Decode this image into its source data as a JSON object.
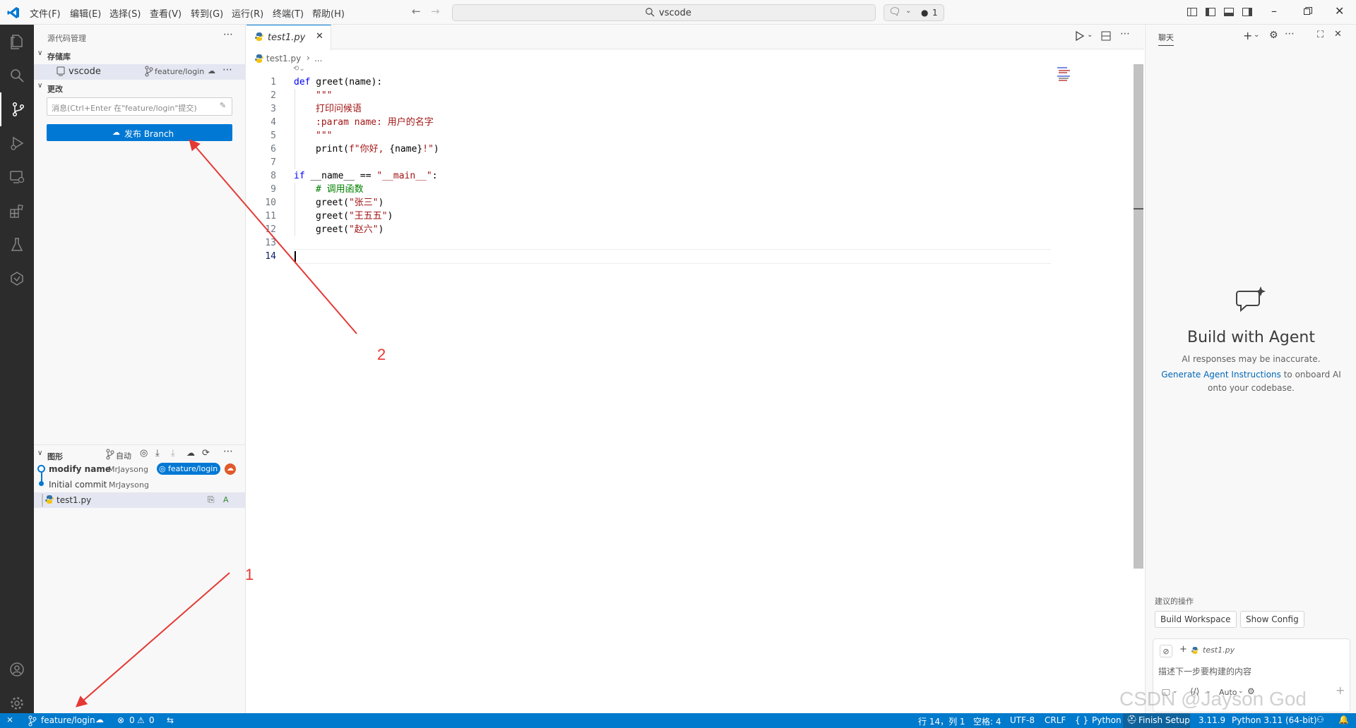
{
  "titlebar": {
    "menus": [
      "文件(F)",
      "编辑(E)",
      "选择(S)",
      "查看(V)",
      "转到(G)",
      "运行(R)",
      "终端(T)",
      "帮助(H)"
    ],
    "search_text": "vscode",
    "badge": "1"
  },
  "sidebar": {
    "title": "源代码管理",
    "repos_header": "存储库",
    "repo_name": "vscode",
    "repo_branch": "feature/login",
    "changes_header": "更改",
    "commit_placeholder": "消息(Ctrl+Enter 在\"feature/login\"提交)",
    "publish_label": "发布 Branch",
    "graph_header": "图形",
    "graph_auto": "自动",
    "commits": [
      {
        "message": "modify name",
        "author": "MrJaysong",
        "branch": "feature/login"
      },
      {
        "message": "Initial commit",
        "author": "MrJaysong"
      }
    ],
    "file": {
      "name": "test1.py",
      "status": "A"
    }
  },
  "editor": {
    "tab_label": "test1.py",
    "breadcrumb_file": "test1.py",
    "breadcrumb_more": "...",
    "line_numbers": [
      "1",
      "2",
      "3",
      "4",
      "5",
      "6",
      "7",
      "8",
      "9",
      "10",
      "11",
      "12",
      "13",
      "14"
    ],
    "code": {
      "l1_kw": "def",
      "l1_rest": " greet(name):",
      "l2": "\"\"\"",
      "l3": "打印问候语",
      "l4": ":param name: 用户的名字",
      "l5": "\"\"\"",
      "l6_a": "print(",
      "l6_b": "f\"你好, ",
      "l6_c": "{name}",
      "l6_d": "!\"",
      "l6_e": ")",
      "l8_kw": "if",
      "l8_rest": " __name__ == ",
      "l8_str": "\"__main__\"",
      "l8_end": ":",
      "l9": "# 调用函数",
      "l10_a": "greet(",
      "l10_b": "\"张三\"",
      "l10_c": ")",
      "l11_a": "greet(",
      "l11_b": "\"王五五\"",
      "l11_c": ")",
      "l12_a": "greet(",
      "l12_b": "\"赵六\"",
      "l12_c": ")"
    }
  },
  "annotations": {
    "label_1": "1",
    "label_2": "2",
    "arrow_color": "#e53935"
  },
  "chat": {
    "tab": "聊天",
    "heading": "Build with Agent",
    "disclaimer": "AI responses may be inaccurate.",
    "link": "Generate Agent Instructions",
    "link_rest": " to onboard AI",
    "line3": "onto your codebase.",
    "suggest_header": "建议的操作",
    "suggest_1": "Build Workspace",
    "suggest_2": "Show Config",
    "attach_file": "test1.py",
    "input_placeholder": "描述下一步要构建的内容",
    "mode": "Auto"
  },
  "statusbar": {
    "branch": "feature/login",
    "errors": "0",
    "warnings": "0",
    "position": "行 14，列 1",
    "spaces": "空格: 4",
    "encoding": "UTF-8",
    "eol": "CRLF",
    "language": "Python",
    "finish_setup": "Finish Setup",
    "py_version": "3.11.9",
    "interpreter": "Python 3.11 (64-bit)"
  },
  "watermark": "CSDN @Jayson God",
  "colors": {
    "accent": "#007acc",
    "button": "#0078d4",
    "activity": "#2c2c2c"
  }
}
